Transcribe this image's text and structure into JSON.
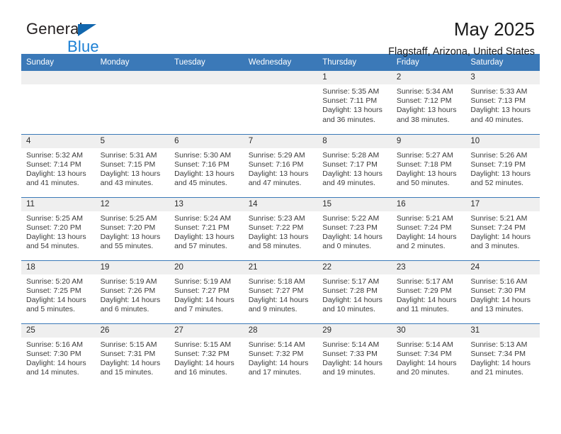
{
  "brand": {
    "word1": "General",
    "word2": "Blue",
    "logo_icon": "triangle-logo-icon",
    "color_dark": "#231f20",
    "color_blue": "#1b7fd4",
    "color_triangle": "#1267ae"
  },
  "header": {
    "title": "May 2025",
    "location": "Flagstaff, Arizona, United States"
  },
  "theme": {
    "header_row_bg": "#3b79b8",
    "header_row_text": "#ffffff",
    "daynum_bg": "#efefef",
    "row_divider": "#3b79b8",
    "body_text": "#3b3b3b"
  },
  "weekday_headers": [
    "Sunday",
    "Monday",
    "Tuesday",
    "Wednesday",
    "Thursday",
    "Friday",
    "Saturday"
  ],
  "labels": {
    "sunrise_prefix": "Sunrise:",
    "sunset_prefix": "Sunset:",
    "daylight_prefix": "Daylight:"
  },
  "weeks": [
    [
      {
        "day": "",
        "blank": true,
        "line1": "",
        "line2": "",
        "line3": "",
        "line4": ""
      },
      {
        "day": "",
        "blank": true,
        "line1": "",
        "line2": "",
        "line3": "",
        "line4": ""
      },
      {
        "day": "",
        "blank": true,
        "line1": "",
        "line2": "",
        "line3": "",
        "line4": ""
      },
      {
        "day": "",
        "blank": true,
        "line1": "",
        "line2": "",
        "line3": "",
        "line4": ""
      },
      {
        "day": "1",
        "blank": false,
        "line1": "Sunrise: 5:35 AM",
        "line2": "Sunset: 7:11 PM",
        "line3": "Daylight: 13 hours",
        "line4": "and 36 minutes."
      },
      {
        "day": "2",
        "blank": false,
        "line1": "Sunrise: 5:34 AM",
        "line2": "Sunset: 7:12 PM",
        "line3": "Daylight: 13 hours",
        "line4": "and 38 minutes."
      },
      {
        "day": "3",
        "blank": false,
        "line1": "Sunrise: 5:33 AM",
        "line2": "Sunset: 7:13 PM",
        "line3": "Daylight: 13 hours",
        "line4": "and 40 minutes."
      }
    ],
    [
      {
        "day": "4",
        "blank": false,
        "line1": "Sunrise: 5:32 AM",
        "line2": "Sunset: 7:14 PM",
        "line3": "Daylight: 13 hours",
        "line4": "and 41 minutes."
      },
      {
        "day": "5",
        "blank": false,
        "line1": "Sunrise: 5:31 AM",
        "line2": "Sunset: 7:15 PM",
        "line3": "Daylight: 13 hours",
        "line4": "and 43 minutes."
      },
      {
        "day": "6",
        "blank": false,
        "line1": "Sunrise: 5:30 AM",
        "line2": "Sunset: 7:16 PM",
        "line3": "Daylight: 13 hours",
        "line4": "and 45 minutes."
      },
      {
        "day": "7",
        "blank": false,
        "line1": "Sunrise: 5:29 AM",
        "line2": "Sunset: 7:16 PM",
        "line3": "Daylight: 13 hours",
        "line4": "and 47 minutes."
      },
      {
        "day": "8",
        "blank": false,
        "line1": "Sunrise: 5:28 AM",
        "line2": "Sunset: 7:17 PM",
        "line3": "Daylight: 13 hours",
        "line4": "and 49 minutes."
      },
      {
        "day": "9",
        "blank": false,
        "line1": "Sunrise: 5:27 AM",
        "line2": "Sunset: 7:18 PM",
        "line3": "Daylight: 13 hours",
        "line4": "and 50 minutes."
      },
      {
        "day": "10",
        "blank": false,
        "line1": "Sunrise: 5:26 AM",
        "line2": "Sunset: 7:19 PM",
        "line3": "Daylight: 13 hours",
        "line4": "and 52 minutes."
      }
    ],
    [
      {
        "day": "11",
        "blank": false,
        "line1": "Sunrise: 5:25 AM",
        "line2": "Sunset: 7:20 PM",
        "line3": "Daylight: 13 hours",
        "line4": "and 54 minutes."
      },
      {
        "day": "12",
        "blank": false,
        "line1": "Sunrise: 5:25 AM",
        "line2": "Sunset: 7:20 PM",
        "line3": "Daylight: 13 hours",
        "line4": "and 55 minutes."
      },
      {
        "day": "13",
        "blank": false,
        "line1": "Sunrise: 5:24 AM",
        "line2": "Sunset: 7:21 PM",
        "line3": "Daylight: 13 hours",
        "line4": "and 57 minutes."
      },
      {
        "day": "14",
        "blank": false,
        "line1": "Sunrise: 5:23 AM",
        "line2": "Sunset: 7:22 PM",
        "line3": "Daylight: 13 hours",
        "line4": "and 58 minutes."
      },
      {
        "day": "15",
        "blank": false,
        "line1": "Sunrise: 5:22 AM",
        "line2": "Sunset: 7:23 PM",
        "line3": "Daylight: 14 hours",
        "line4": "and 0 minutes."
      },
      {
        "day": "16",
        "blank": false,
        "line1": "Sunrise: 5:21 AM",
        "line2": "Sunset: 7:24 PM",
        "line3": "Daylight: 14 hours",
        "line4": "and 2 minutes."
      },
      {
        "day": "17",
        "blank": false,
        "line1": "Sunrise: 5:21 AM",
        "line2": "Sunset: 7:24 PM",
        "line3": "Daylight: 14 hours",
        "line4": "and 3 minutes."
      }
    ],
    [
      {
        "day": "18",
        "blank": false,
        "line1": "Sunrise: 5:20 AM",
        "line2": "Sunset: 7:25 PM",
        "line3": "Daylight: 14 hours",
        "line4": "and 5 minutes."
      },
      {
        "day": "19",
        "blank": false,
        "line1": "Sunrise: 5:19 AM",
        "line2": "Sunset: 7:26 PM",
        "line3": "Daylight: 14 hours",
        "line4": "and 6 minutes."
      },
      {
        "day": "20",
        "blank": false,
        "line1": "Sunrise: 5:19 AM",
        "line2": "Sunset: 7:27 PM",
        "line3": "Daylight: 14 hours",
        "line4": "and 7 minutes."
      },
      {
        "day": "21",
        "blank": false,
        "line1": "Sunrise: 5:18 AM",
        "line2": "Sunset: 7:27 PM",
        "line3": "Daylight: 14 hours",
        "line4": "and 9 minutes."
      },
      {
        "day": "22",
        "blank": false,
        "line1": "Sunrise: 5:17 AM",
        "line2": "Sunset: 7:28 PM",
        "line3": "Daylight: 14 hours",
        "line4": "and 10 minutes."
      },
      {
        "day": "23",
        "blank": false,
        "line1": "Sunrise: 5:17 AM",
        "line2": "Sunset: 7:29 PM",
        "line3": "Daylight: 14 hours",
        "line4": "and 11 minutes."
      },
      {
        "day": "24",
        "blank": false,
        "line1": "Sunrise: 5:16 AM",
        "line2": "Sunset: 7:30 PM",
        "line3": "Daylight: 14 hours",
        "line4": "and 13 minutes."
      }
    ],
    [
      {
        "day": "25",
        "blank": false,
        "line1": "Sunrise: 5:16 AM",
        "line2": "Sunset: 7:30 PM",
        "line3": "Daylight: 14 hours",
        "line4": "and 14 minutes."
      },
      {
        "day": "26",
        "blank": false,
        "line1": "Sunrise: 5:15 AM",
        "line2": "Sunset: 7:31 PM",
        "line3": "Daylight: 14 hours",
        "line4": "and 15 minutes."
      },
      {
        "day": "27",
        "blank": false,
        "line1": "Sunrise: 5:15 AM",
        "line2": "Sunset: 7:32 PM",
        "line3": "Daylight: 14 hours",
        "line4": "and 16 minutes."
      },
      {
        "day": "28",
        "blank": false,
        "line1": "Sunrise: 5:14 AM",
        "line2": "Sunset: 7:32 PM",
        "line3": "Daylight: 14 hours",
        "line4": "and 17 minutes."
      },
      {
        "day": "29",
        "blank": false,
        "line1": "Sunrise: 5:14 AM",
        "line2": "Sunset: 7:33 PM",
        "line3": "Daylight: 14 hours",
        "line4": "and 19 minutes."
      },
      {
        "day": "30",
        "blank": false,
        "line1": "Sunrise: 5:14 AM",
        "line2": "Sunset: 7:34 PM",
        "line3": "Daylight: 14 hours",
        "line4": "and 20 minutes."
      },
      {
        "day": "31",
        "blank": false,
        "line1": "Sunrise: 5:13 AM",
        "line2": "Sunset: 7:34 PM",
        "line3": "Daylight: 14 hours",
        "line4": "and 21 minutes."
      }
    ]
  ]
}
